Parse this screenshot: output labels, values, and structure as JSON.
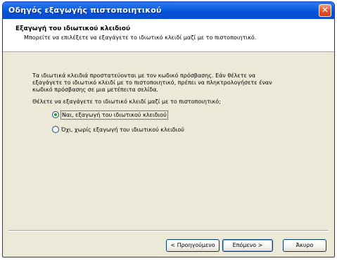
{
  "window": {
    "title": "Οδηγός εξαγωγής πιστοποιητικού",
    "close_glyph": "✕"
  },
  "header": {
    "title": "Εξαγωγή του ιδιωτικού κλειδιού",
    "subtitle": "Μπορείτε να επιλέξετε να εξαγάγετε το ιδιωτικό κλειδί μαζί με το πιστοποιητικό."
  },
  "body": {
    "paragraph_lines": [
      "Τα ιδιωτικά κλειδιά προστατεύονται με τον κωδικό πρόσβασης. Εάν θέλετε να",
      "εξαγάγετε το ιδιωτικό κλειδί με το πιστοποιητικό, πρέπει να πληκτρολογήσετε έναν",
      "κωδικό πρόσβασης σε μια μετέπειτα σελίδα."
    ],
    "question": "Θέλετε να εξαγάγετε το ιδιωτικό κλειδί μαζί με το πιστοποιητικό;",
    "options": [
      {
        "label": "Ναι, εξαγωγή του ιδιωτικού κλειδιού",
        "selected": true
      },
      {
        "label": "Όχι, χωρίς εξαγωγή του ιδιωτικού κλειδιού",
        "selected": false
      }
    ]
  },
  "buttons": {
    "back": "< Προηγούμενο",
    "next": "Επόμενο >",
    "cancel": "Άκυρο"
  },
  "colors": {
    "titlebar": "#0a5fe0",
    "dialog_face": "#ece9d8",
    "radio_dot": "#21a121",
    "close_button": "#e2552e"
  }
}
